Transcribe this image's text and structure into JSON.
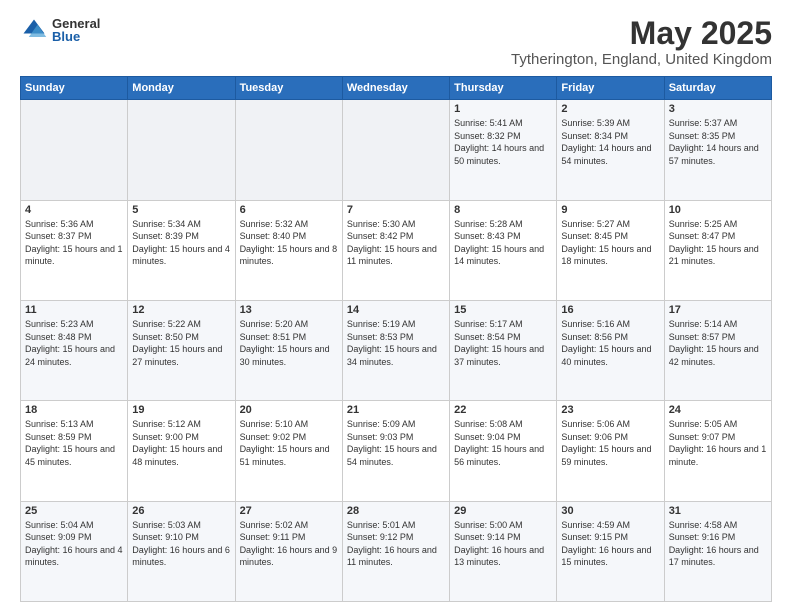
{
  "logo": {
    "general": "General",
    "blue": "Blue"
  },
  "title": "May 2025",
  "subtitle": "Tytherington, England, United Kingdom",
  "days_of_week": [
    "Sunday",
    "Monday",
    "Tuesday",
    "Wednesday",
    "Thursday",
    "Friday",
    "Saturday"
  ],
  "weeks": [
    [
      {
        "day": "",
        "sunrise": "",
        "sunset": "",
        "daylight": ""
      },
      {
        "day": "",
        "sunrise": "",
        "sunset": "",
        "daylight": ""
      },
      {
        "day": "",
        "sunrise": "",
        "sunset": "",
        "daylight": ""
      },
      {
        "day": "",
        "sunrise": "",
        "sunset": "",
        "daylight": ""
      },
      {
        "day": "1",
        "sunrise": "Sunrise: 5:41 AM",
        "sunset": "Sunset: 8:32 PM",
        "daylight": "Daylight: 14 hours and 50 minutes."
      },
      {
        "day": "2",
        "sunrise": "Sunrise: 5:39 AM",
        "sunset": "Sunset: 8:34 PM",
        "daylight": "Daylight: 14 hours and 54 minutes."
      },
      {
        "day": "3",
        "sunrise": "Sunrise: 5:37 AM",
        "sunset": "Sunset: 8:35 PM",
        "daylight": "Daylight: 14 hours and 57 minutes."
      }
    ],
    [
      {
        "day": "4",
        "sunrise": "Sunrise: 5:36 AM",
        "sunset": "Sunset: 8:37 PM",
        "daylight": "Daylight: 15 hours and 1 minute."
      },
      {
        "day": "5",
        "sunrise": "Sunrise: 5:34 AM",
        "sunset": "Sunset: 8:39 PM",
        "daylight": "Daylight: 15 hours and 4 minutes."
      },
      {
        "day": "6",
        "sunrise": "Sunrise: 5:32 AM",
        "sunset": "Sunset: 8:40 PM",
        "daylight": "Daylight: 15 hours and 8 minutes."
      },
      {
        "day": "7",
        "sunrise": "Sunrise: 5:30 AM",
        "sunset": "Sunset: 8:42 PM",
        "daylight": "Daylight: 15 hours and 11 minutes."
      },
      {
        "day": "8",
        "sunrise": "Sunrise: 5:28 AM",
        "sunset": "Sunset: 8:43 PM",
        "daylight": "Daylight: 15 hours and 14 minutes."
      },
      {
        "day": "9",
        "sunrise": "Sunrise: 5:27 AM",
        "sunset": "Sunset: 8:45 PM",
        "daylight": "Daylight: 15 hours and 18 minutes."
      },
      {
        "day": "10",
        "sunrise": "Sunrise: 5:25 AM",
        "sunset": "Sunset: 8:47 PM",
        "daylight": "Daylight: 15 hours and 21 minutes."
      }
    ],
    [
      {
        "day": "11",
        "sunrise": "Sunrise: 5:23 AM",
        "sunset": "Sunset: 8:48 PM",
        "daylight": "Daylight: 15 hours and 24 minutes."
      },
      {
        "day": "12",
        "sunrise": "Sunrise: 5:22 AM",
        "sunset": "Sunset: 8:50 PM",
        "daylight": "Daylight: 15 hours and 27 minutes."
      },
      {
        "day": "13",
        "sunrise": "Sunrise: 5:20 AM",
        "sunset": "Sunset: 8:51 PM",
        "daylight": "Daylight: 15 hours and 30 minutes."
      },
      {
        "day": "14",
        "sunrise": "Sunrise: 5:19 AM",
        "sunset": "Sunset: 8:53 PM",
        "daylight": "Daylight: 15 hours and 34 minutes."
      },
      {
        "day": "15",
        "sunrise": "Sunrise: 5:17 AM",
        "sunset": "Sunset: 8:54 PM",
        "daylight": "Daylight: 15 hours and 37 minutes."
      },
      {
        "day": "16",
        "sunrise": "Sunrise: 5:16 AM",
        "sunset": "Sunset: 8:56 PM",
        "daylight": "Daylight: 15 hours and 40 minutes."
      },
      {
        "day": "17",
        "sunrise": "Sunrise: 5:14 AM",
        "sunset": "Sunset: 8:57 PM",
        "daylight": "Daylight: 15 hours and 42 minutes."
      }
    ],
    [
      {
        "day": "18",
        "sunrise": "Sunrise: 5:13 AM",
        "sunset": "Sunset: 8:59 PM",
        "daylight": "Daylight: 15 hours and 45 minutes."
      },
      {
        "day": "19",
        "sunrise": "Sunrise: 5:12 AM",
        "sunset": "Sunset: 9:00 PM",
        "daylight": "Daylight: 15 hours and 48 minutes."
      },
      {
        "day": "20",
        "sunrise": "Sunrise: 5:10 AM",
        "sunset": "Sunset: 9:02 PM",
        "daylight": "Daylight: 15 hours and 51 minutes."
      },
      {
        "day": "21",
        "sunrise": "Sunrise: 5:09 AM",
        "sunset": "Sunset: 9:03 PM",
        "daylight": "Daylight: 15 hours and 54 minutes."
      },
      {
        "day": "22",
        "sunrise": "Sunrise: 5:08 AM",
        "sunset": "Sunset: 9:04 PM",
        "daylight": "Daylight: 15 hours and 56 minutes."
      },
      {
        "day": "23",
        "sunrise": "Sunrise: 5:06 AM",
        "sunset": "Sunset: 9:06 PM",
        "daylight": "Daylight: 15 hours and 59 minutes."
      },
      {
        "day": "24",
        "sunrise": "Sunrise: 5:05 AM",
        "sunset": "Sunset: 9:07 PM",
        "daylight": "Daylight: 16 hours and 1 minute."
      }
    ],
    [
      {
        "day": "25",
        "sunrise": "Sunrise: 5:04 AM",
        "sunset": "Sunset: 9:09 PM",
        "daylight": "Daylight: 16 hours and 4 minutes."
      },
      {
        "day": "26",
        "sunrise": "Sunrise: 5:03 AM",
        "sunset": "Sunset: 9:10 PM",
        "daylight": "Daylight: 16 hours and 6 minutes."
      },
      {
        "day": "27",
        "sunrise": "Sunrise: 5:02 AM",
        "sunset": "Sunset: 9:11 PM",
        "daylight": "Daylight: 16 hours and 9 minutes."
      },
      {
        "day": "28",
        "sunrise": "Sunrise: 5:01 AM",
        "sunset": "Sunset: 9:12 PM",
        "daylight": "Daylight: 16 hours and 11 minutes."
      },
      {
        "day": "29",
        "sunrise": "Sunrise: 5:00 AM",
        "sunset": "Sunset: 9:14 PM",
        "daylight": "Daylight: 16 hours and 13 minutes."
      },
      {
        "day": "30",
        "sunrise": "Sunrise: 4:59 AM",
        "sunset": "Sunset: 9:15 PM",
        "daylight": "Daylight: 16 hours and 15 minutes."
      },
      {
        "day": "31",
        "sunrise": "Sunrise: 4:58 AM",
        "sunset": "Sunset: 9:16 PM",
        "daylight": "Daylight: 16 hours and 17 minutes."
      }
    ]
  ]
}
